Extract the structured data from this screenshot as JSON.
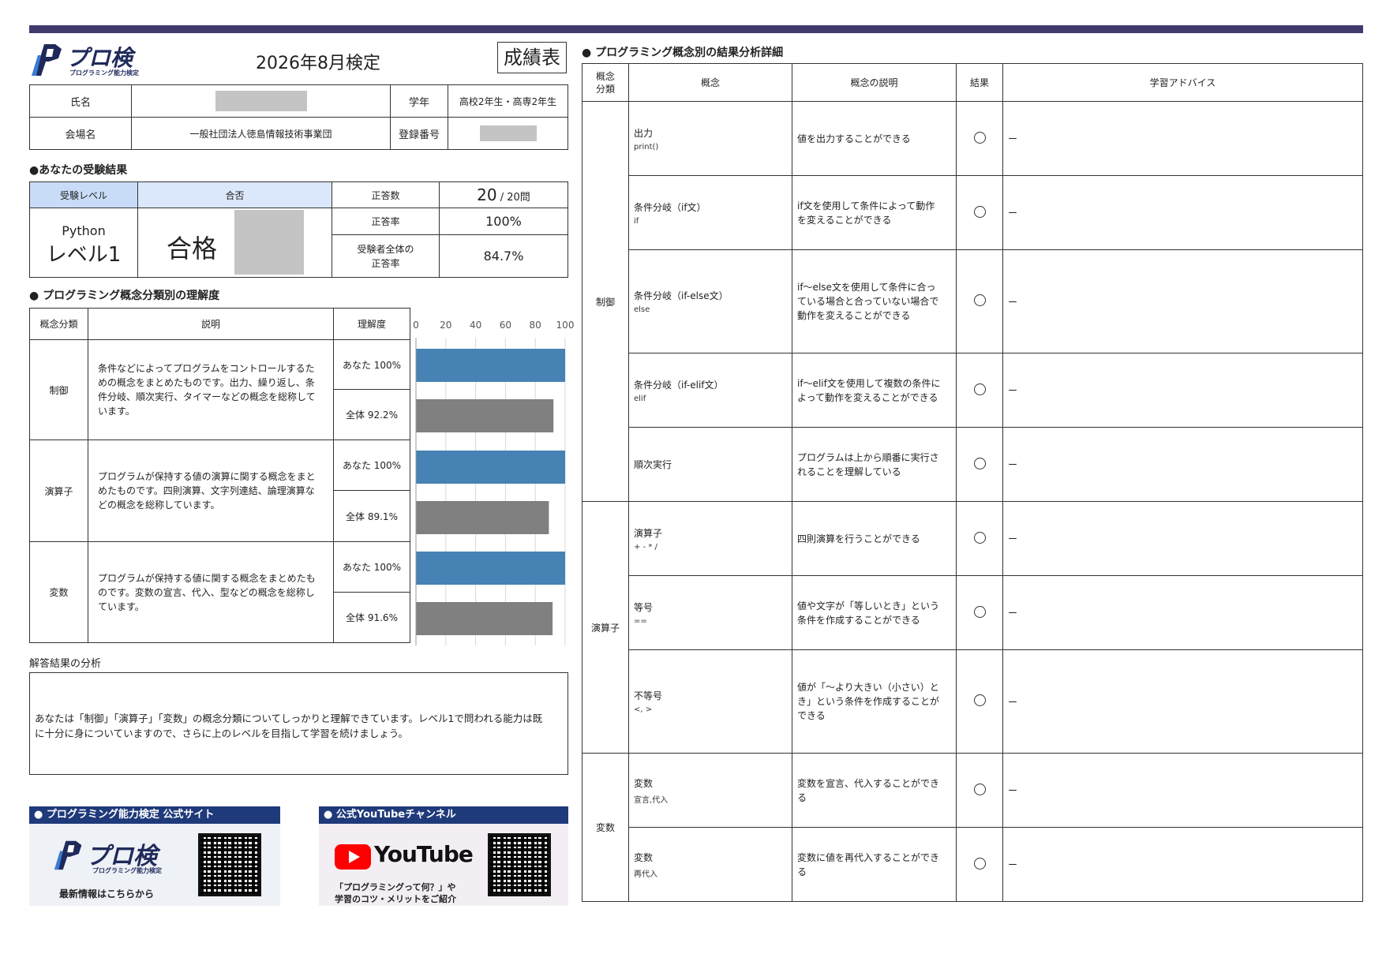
{
  "header": {
    "logo_text": "プロ検",
    "logo_sub": "プログラミング能力検定",
    "exam_title": "2026年8月検定",
    "report_label": "成績表"
  },
  "info": {
    "name_label": "氏名",
    "grade_label": "学年",
    "grade_value": "高校2年生・高専2年生",
    "venue_label": "会場名",
    "venue_value": "一般社団法人徳島情報技術事業団",
    "reg_label": "登録番号"
  },
  "result": {
    "section_title": "●あなたの受験結果",
    "level_header": "受験レベル",
    "pass_header": "合否",
    "correct_count_label": "正答数",
    "correct_count_value": "20",
    "correct_count_total": " / 20問",
    "correct_rate_label": "正答率",
    "correct_rate_value": "100%",
    "all_rate_label_1": "受験者全体の",
    "all_rate_label_2": "正答率",
    "all_rate_value": "84.7%",
    "language": "Python",
    "level": "レベル1",
    "pass_value": "合格"
  },
  "concept": {
    "section_title": "● プログラミング概念分類別の理解度",
    "col_category": "概念分類",
    "col_desc": "説明",
    "col_understanding": "理解度",
    "rows": [
      {
        "category": "制御",
        "desc": "条件などによってプログラムをコントロールするための概念をまとめたものです。出力、繰り返し、条件分岐、順次実行、タイマーなどの概念を総称しています。",
        "you": "あなた 100%",
        "all": "全体 92.2%"
      },
      {
        "category": "演算子",
        "desc": "プログラムが保持する値の演算に関する概念をまとめたものです。四則演算、文字列連結、論理演算などの概念を総称しています。",
        "you": "あなた 100%",
        "all": "全体 89.1%"
      },
      {
        "category": "変数",
        "desc": "プログラムが保持する値に関する概念をまとめたものです。変数の宣言、代入、型などの概念を総称しています。",
        "you": "あなた 100%",
        "all": "全体 91.6%"
      }
    ]
  },
  "chart_data": {
    "type": "bar",
    "orientation": "horizontal",
    "categories": [
      "制御",
      "演算子",
      "変数"
    ],
    "series": [
      {
        "name": "あなた",
        "values": [
          100,
          100,
          100
        ]
      },
      {
        "name": "全体",
        "values": [
          92.2,
          89.1,
          91.6
        ]
      }
    ],
    "ticks": [
      "0",
      "20",
      "40",
      "60",
      "80",
      "100"
    ],
    "xlim": [
      0,
      100
    ],
    "colors": {
      "you": "#4682b4",
      "all": "#808080"
    }
  },
  "analysis": {
    "title": "解答結果の分析",
    "text_1": "あなたは「制御」「演算子」「変数」の概念分類についてしっかりと理解できています。レベル1で問われる能力は既",
    "text_2": "に十分に身についていますので、さらに上のレベルを目指して学習を続けましょう。"
  },
  "banners": {
    "site_title": "● プログラミング能力検定 公式サイト",
    "site_logo": "プロ検",
    "site_logo_sub": "プログラミング能力検定",
    "site_caption": "最新情報はこちらから",
    "yt_title": "● 公式YouTubeチャンネル",
    "yt_logo": "YouTube",
    "yt_caption_1": "「プログラミングって何？」や",
    "yt_caption_2": "学習のコツ・メリットをご紹介"
  },
  "detail": {
    "section_title": "● プログラミング概念別の結果分析詳細",
    "col_category_1": "概念",
    "col_category_2": "分類",
    "col_concept": "概念",
    "col_desc": "概念の説明",
    "col_result": "結果",
    "col_advice": "学習アドバイス",
    "groups": [
      {
        "category": "制御",
        "rows": [
          {
            "concept": "出力",
            "sub": "print()",
            "desc": [
              "値を出力することができる"
            ],
            "advice": "ー"
          },
          {
            "concept": "条件分岐（if文）",
            "sub": "if",
            "desc": [
              "if文を使用して条件によって動作",
              "を変えることができる"
            ],
            "advice": "ー"
          },
          {
            "concept": "条件分岐（if-else文）",
            "sub": "else",
            "desc": [
              "if〜else文を使用して条件に合っ",
              "ている場合と合っていない場合で",
              "動作を変えることができる"
            ],
            "advice": "ー"
          },
          {
            "concept": "条件分岐（if-elif文）",
            "sub": "elif",
            "desc": [
              "if〜elif文を使用して複数の条件に",
              "よって動作を変えることができる"
            ],
            "advice": "ー"
          },
          {
            "concept": "順次実行",
            "sub": "",
            "desc": [
              "プログラムは上から順番に実行さ",
              "れることを理解している"
            ],
            "advice": "ー"
          }
        ]
      },
      {
        "category": "演算子",
        "rows": [
          {
            "concept": "演算子",
            "sub": "+ - * /",
            "desc": [
              "四則演算を行うことができる"
            ],
            "advice": "ー"
          },
          {
            "concept": "等号",
            "sub": "==",
            "desc": [
              "値や文字が「等しいとき」という",
              "条件を作成することができる"
            ],
            "advice": "ー"
          },
          {
            "concept": "不等号",
            "sub": "<, >",
            "desc": [
              "値が「〜より大きい（小さい）と",
              "き」という条件を作成することが",
              "できる"
            ],
            "advice": "ー"
          }
        ]
      },
      {
        "category": "変数",
        "rows": [
          {
            "concept": "変数",
            "sub": "宣言,代入",
            "desc": [
              "変数を宣言、代入することができ",
              "る"
            ],
            "advice": "ー"
          },
          {
            "concept": "変数",
            "sub": "再代入",
            "desc": [
              "変数に値を再代入することができ",
              "る"
            ],
            "advice": "ー"
          }
        ]
      }
    ]
  }
}
